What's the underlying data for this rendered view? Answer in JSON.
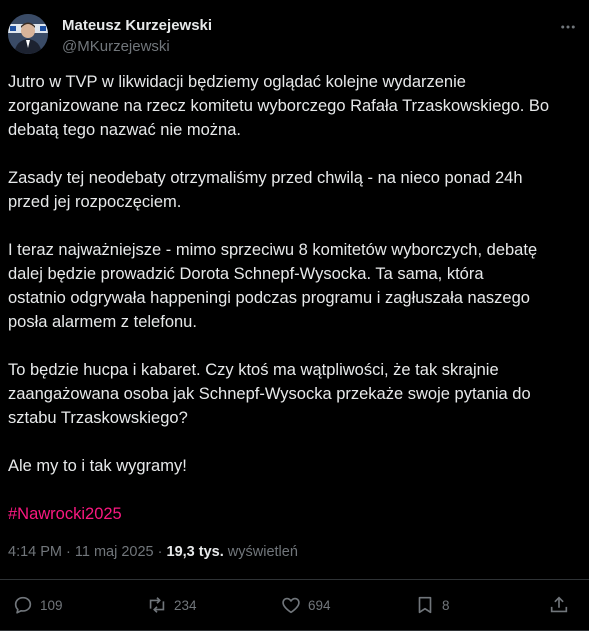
{
  "author": {
    "name": "Mateusz Kurzejewski",
    "handle": "@MKurzejewski"
  },
  "post": {
    "paragraphs": [
      [
        "Jutro w TVP w likwidacji będziemy oglądać kolejne wydarzenie",
        "zorganizowane na rzecz komitetu wyborczego Rafała Trzaskowskiego. Bo",
        "debatą tego nazwać nie można."
      ],
      [
        "Zasady tej neodebaty otrzymaliśmy przed chwilą - na nieco ponad 24h",
        "przed jej rozpoczęciem."
      ],
      [
        "I teraz najważniejsze - mimo sprzeciwu 8 komitetów wyborczych, debatę",
        "dalej będzie prowadzić Dorota Schnepf-Wysocka. Ta sama, która",
        "ostatnio odgrywała happeningi podczas programu i zagłuszała naszego",
        "posła alarmem z telefonu."
      ],
      [
        "To będzie hucpa i kabaret. Czy ktoś ma wątpliwości, że tak skrajnie",
        "zaangażowana osoba jak Schnepf-Wysocka przekaże swoje pytania  do",
        "sztabu Trzaskowskiego?"
      ],
      [
        "Ale my to i tak wygramy!"
      ]
    ],
    "hashtag": "#Nawrocki2025",
    "time": "4:14 PM",
    "date": "11 maj 2025",
    "views_count": "19,3 tys.",
    "views_label": "wyświetleń"
  },
  "actions": {
    "replies": "109",
    "reposts": "234",
    "likes": "694",
    "bookmarks": "8"
  },
  "colors": {
    "background": "#000000",
    "text": "#e7e9ea",
    "muted": "#71767b",
    "hashtag": "#f91880",
    "divider": "#2f3336"
  },
  "icons": [
    "more-icon",
    "reply-icon",
    "repost-icon",
    "like-icon",
    "bookmark-icon",
    "share-icon"
  ]
}
